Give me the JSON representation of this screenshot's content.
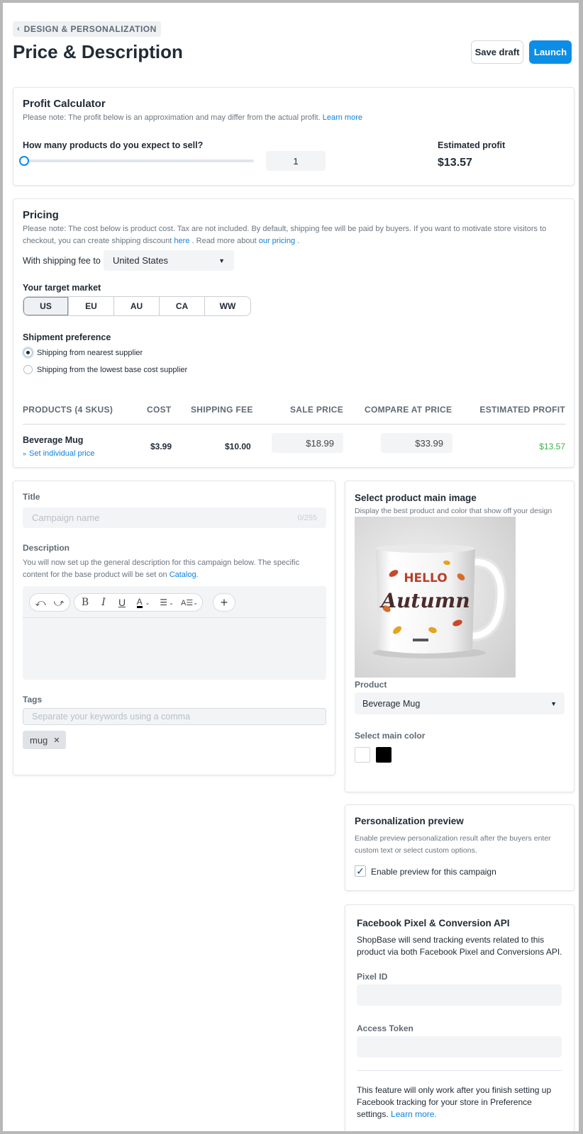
{
  "header": {
    "back_label": "DESIGN & PERSONALIZATION",
    "title": "Price & Description",
    "save_draft": "Save draft",
    "launch": "Launch"
  },
  "profit_calculator": {
    "title": "Profit Calculator",
    "note": "Please note: The profit below is an approximation and may differ from the actual profit.",
    "learn_more": "Learn more",
    "question": "How many products do you expect to sell?",
    "quantity": "1",
    "slider_fraction": 0,
    "estimated_label": "Estimated profit",
    "estimated_value": "$13.57"
  },
  "pricing": {
    "title": "Pricing",
    "note_part1": "Please note: The cost below is product cost. Tax are not included. By default, shipping fee will be paid by buyers. If you want to motivate store visitors to checkout, you can create shipping discount",
    "here": "here",
    "note_part2": ". Read more about",
    "our_pricing": "our pricing",
    "note_part3": ".",
    "shipping_label": "With shipping fee to",
    "shipping_country": "United States",
    "target_label": "Your target market",
    "markets": [
      "US",
      "EU",
      "AU",
      "CA",
      "WW"
    ],
    "active_market": "US",
    "shipment_label": "Shipment preference",
    "shipment_options": [
      "Shipping from nearest supplier",
      "Shipping from the lowest base cost supplier"
    ],
    "columns": {
      "products": "PRODUCTS (4 SKUS)",
      "cost": "COST",
      "shipping": "SHIPPING FEE",
      "sale": "SALE PRICE",
      "compare": "COMPARE AT PRICE",
      "profit": "ESTIMATED PROFIT"
    },
    "row": {
      "product": "Beverage Mug",
      "set_individual": "Set individual price",
      "cost": "$3.99",
      "shipping": "$10.00",
      "sale": "$18.99",
      "compare": "$33.99",
      "profit": "$13.57"
    }
  },
  "details": {
    "title_label": "Title",
    "title_placeholder": "Campaign name",
    "title_counter": "0/255",
    "description_label": "Description",
    "description_note": "You will now set up the general description for this campaign below. The specific content for the base product will be set on",
    "catalog_link": "Catalog.",
    "tags_label": "Tags",
    "tags_placeholder": "Separate your keywords using a comma",
    "tag": "mug"
  },
  "main_image": {
    "title": "Select product main image",
    "note": "Display the best product and color that show off your design",
    "mug_text_1": "HELLO",
    "mug_text_2": "Autumn",
    "product_label": "Product",
    "product_value": "Beverage Mug",
    "color_label": "Select main color",
    "colors": [
      "#ffffff",
      "#000000"
    ]
  },
  "personalization": {
    "title": "Personalization preview",
    "note": "Enable preview personalization result after the buyers enter custom text or select custom options.",
    "checkbox_label": "Enable preview for this campaign",
    "checked": true
  },
  "facebook": {
    "title": "Facebook Pixel & Conversion API",
    "note": "ShopBase will send tracking events related to this product via both Facebook Pixel and Conversions API.",
    "pixel_label": "Pixel ID",
    "token_label": "Access Token",
    "footer": "This feature will only work after you finish setting up Facebook tracking for your store in Preference settings.",
    "footer_link": "Learn more."
  }
}
